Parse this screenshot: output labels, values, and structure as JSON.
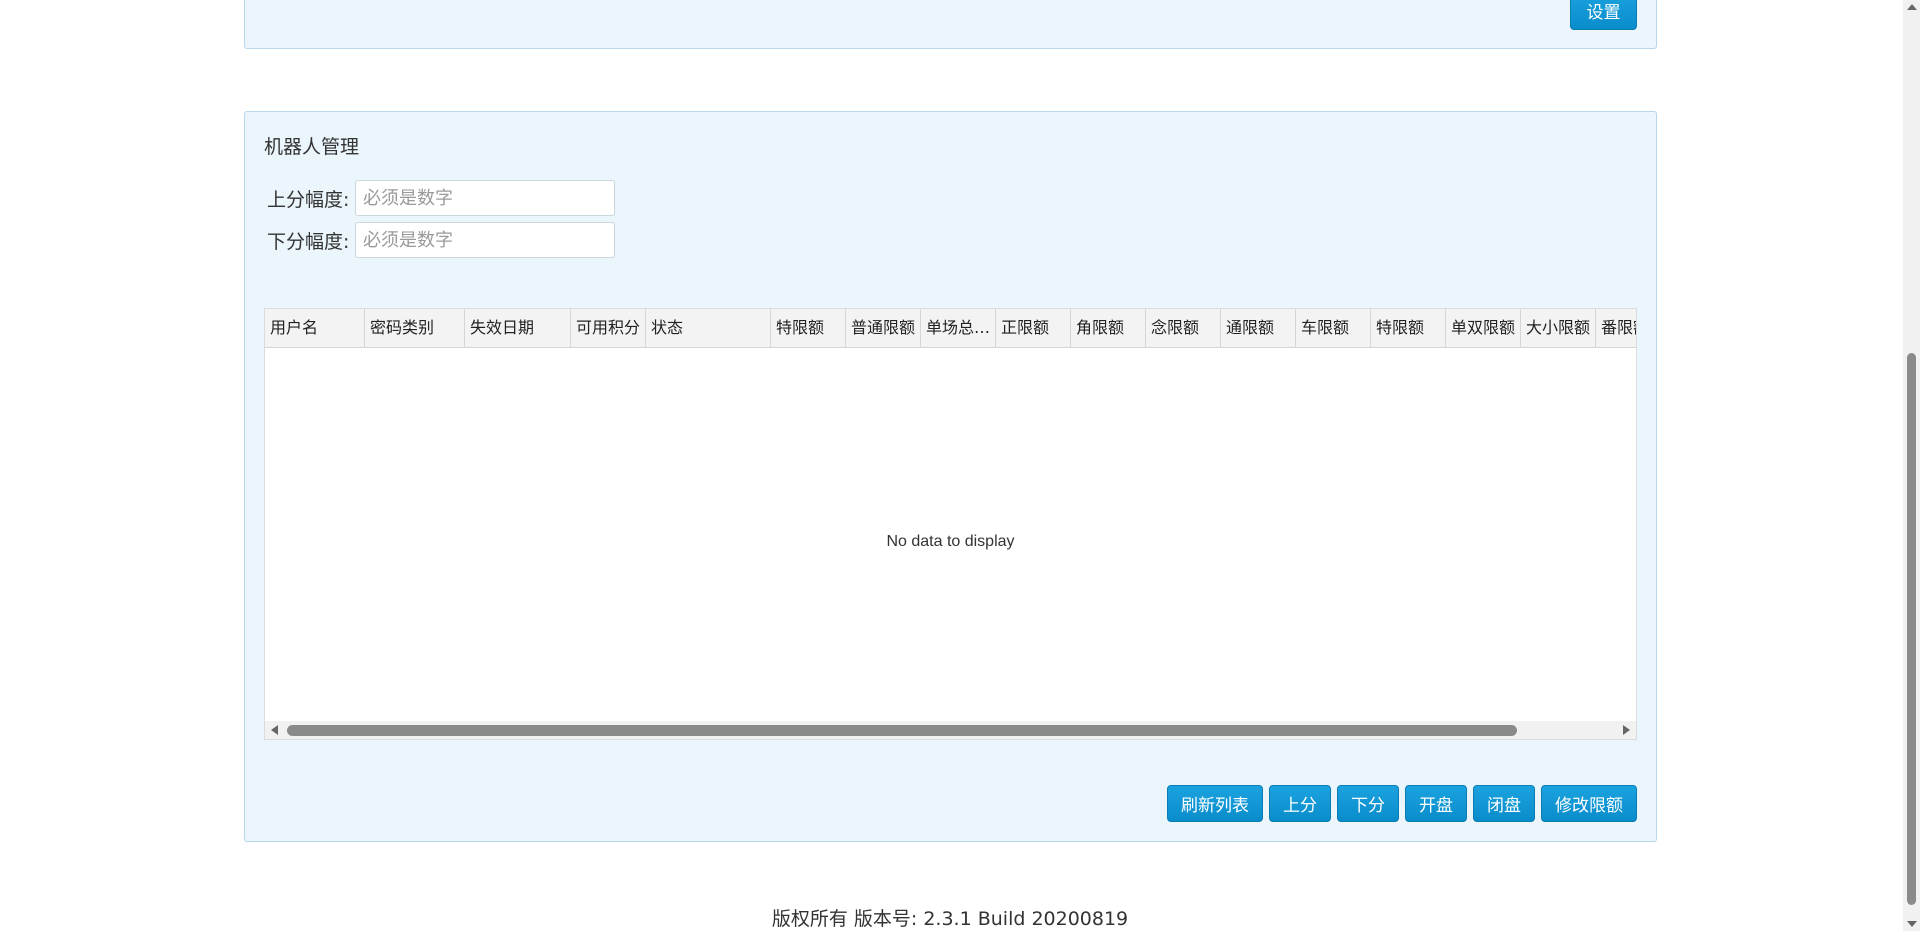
{
  "top_panel": {
    "settings_button": "设置"
  },
  "robot_panel": {
    "title": "机器人管理",
    "up_range": {
      "label": "上分幅度:",
      "placeholder": "必须是数字",
      "value": ""
    },
    "down_range": {
      "label": "下分幅度:",
      "placeholder": "必须是数字",
      "value": ""
    }
  },
  "grid": {
    "columns": [
      "用户名",
      "密码类别",
      "失效日期",
      "可用积分",
      "状态",
      "特限额",
      "普通限额",
      "单场总…",
      "正限额",
      "角限额",
      "念限额",
      "通限额",
      "车限额",
      "特限额",
      "单双限额",
      "大小限额",
      "番限额"
    ],
    "empty_text": "No data to display"
  },
  "actions": {
    "refresh": "刷新列表",
    "up": "上分",
    "down": "下分",
    "open": "开盘",
    "close": "闭盘",
    "modify_limit": "修改限额"
  },
  "footer": {
    "text": "版权所有 版本号: 2.3.1 Build 20200819"
  }
}
